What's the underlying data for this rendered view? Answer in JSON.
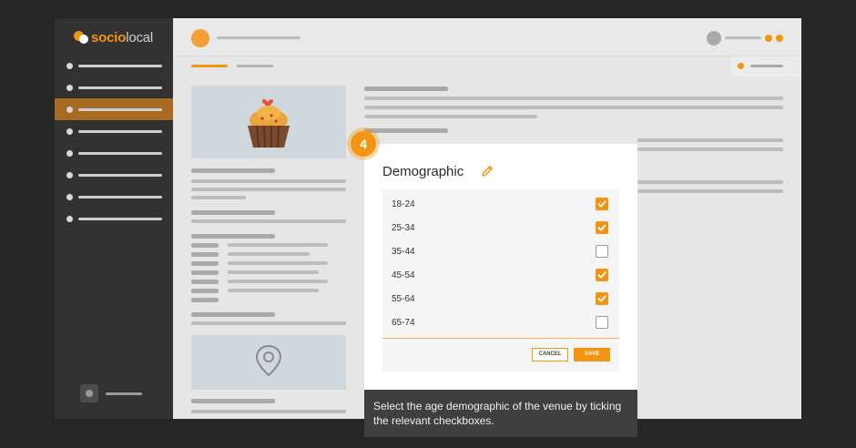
{
  "logo": {
    "accent": "socio",
    "rest": "local"
  },
  "modal": {
    "title": "Demographic",
    "options": [
      {
        "label": "18-24",
        "checked": true
      },
      {
        "label": "25-34",
        "checked": true
      },
      {
        "label": "35-44",
        "checked": false
      },
      {
        "label": "45-54",
        "checked": true
      },
      {
        "label": "55-64",
        "checked": true
      },
      {
        "label": "65-74",
        "checked": false
      }
    ],
    "cancel_label": "CANCEL",
    "save_label": "SAVE"
  },
  "tooltip": {
    "text": "Select the age demographic of the venue by ticking the relevant checkboxes."
  },
  "step": {
    "number": "4"
  },
  "colors": {
    "accent": "#f39512",
    "sidebar": "#323232",
    "active_item": "#a66a23"
  },
  "icons": [
    "logo-icon",
    "edit-icon",
    "checkbox-checked-icon",
    "cupcake-icon",
    "map-pin-icon"
  ]
}
